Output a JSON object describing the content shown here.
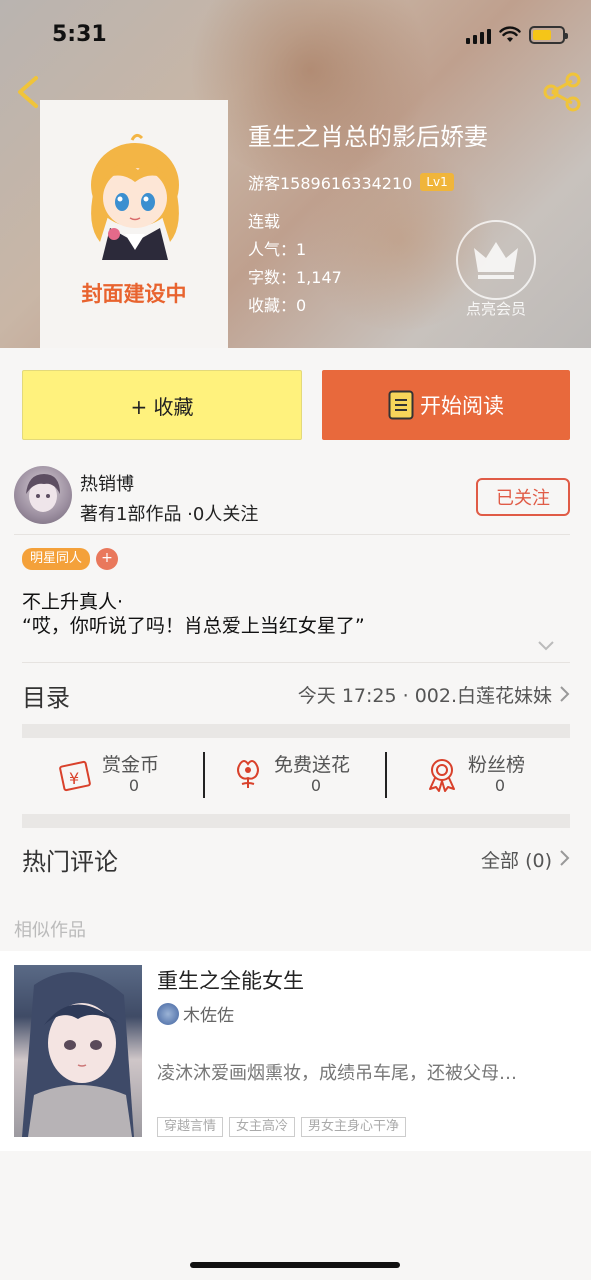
{
  "status_bar": {
    "time": "5:31"
  },
  "book": {
    "title": "重生之肖总的影后娇妻",
    "cover_text": "封面建设中",
    "uploader": "游客1589616334210",
    "level": "Lv1",
    "status": "连载",
    "popularity": "人气：1",
    "word_count": "字数：1,147",
    "favorites": "收藏：0"
  },
  "vip": {
    "label": "点亮会员"
  },
  "actions": {
    "favorite_label": "+ 收藏",
    "read_label": "开始阅读"
  },
  "author": {
    "name": "热销博",
    "stats": "著有1部作品 ·0人关注",
    "follow_label": "已关注"
  },
  "tags": [
    "明星同人"
  ],
  "tag_add": "+",
  "description": {
    "line1": "不上升真人·",
    "line2": "“哎，你听说了吗！肖总爱上当红女星了”"
  },
  "toc": {
    "label": "目录",
    "latest": "今天 17:25 · 002.白莲花妹妹"
  },
  "stats": [
    {
      "name": "赏金币",
      "value": "0",
      "icon": "gold-coin-icon"
    },
    {
      "name": "免费送花",
      "value": "0",
      "icon": "flower-icon"
    },
    {
      "name": "粉丝榜",
      "value": "0",
      "icon": "ribbon-icon"
    }
  ],
  "comments": {
    "label": "热门评论",
    "all": "全部 (0)"
  },
  "similar": {
    "section_title": "相似作品",
    "items": [
      {
        "title": "重生之全能女生",
        "author": "木佐佐",
        "blurb": "凌沐沐爱画烟熏妆，成绩吊车尾，还被父母…",
        "tags": [
          "穿越言情",
          "女主高冷",
          "男女主身心干净"
        ]
      }
    ]
  },
  "colors": {
    "accent_orange": "#e8693c",
    "favorite_yellow": "#fff27d",
    "follow_red": "#e05b46",
    "level_badge": "#f0b53a"
  }
}
